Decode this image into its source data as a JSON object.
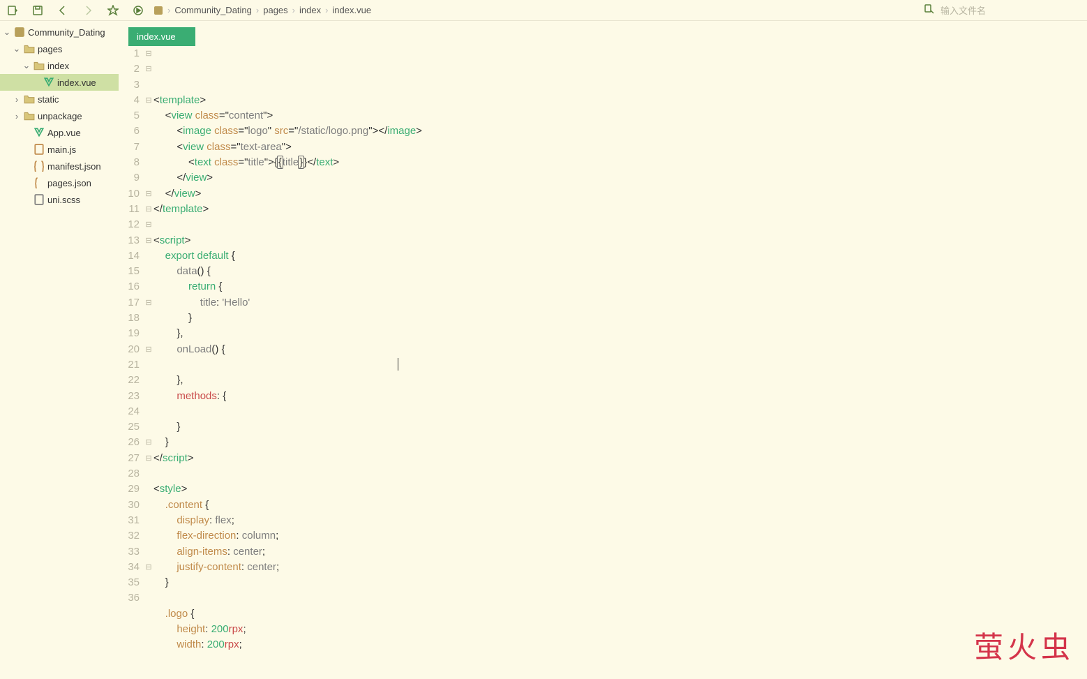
{
  "toolbar": {
    "search_placeholder": "输入文件名"
  },
  "breadcrumbs": [
    "Community_Dating",
    "pages",
    "index",
    "index.vue"
  ],
  "tree": {
    "root": {
      "name": "Community_Dating",
      "kind": "project",
      "open": true,
      "children": [
        {
          "name": "pages",
          "kind": "folder",
          "open": true,
          "children": [
            {
              "name": "index",
              "kind": "folder",
              "open": true,
              "children": [
                {
                  "name": "index.vue",
                  "kind": "vue",
                  "selected": true
                }
              ]
            }
          ]
        },
        {
          "name": "static",
          "kind": "folder",
          "open": false
        },
        {
          "name": "unpackage",
          "kind": "folder",
          "open": false
        },
        {
          "name": "App.vue",
          "kind": "vue"
        },
        {
          "name": "main.js",
          "kind": "js"
        },
        {
          "name": "manifest.json",
          "kind": "json"
        },
        {
          "name": "pages.json",
          "kind": "json"
        },
        {
          "name": "uni.scss",
          "kind": "scss"
        }
      ]
    }
  },
  "tabs": {
    "active": "index.vue"
  },
  "code": {
    "lines": [
      [
        [
          "punc",
          "<"
        ],
        [
          "tag",
          "template"
        ],
        [
          "punc",
          ">"
        ]
      ],
      [
        [
          "ws",
          "    "
        ],
        [
          "punc",
          "<"
        ],
        [
          "tag",
          "view"
        ],
        [
          "ws",
          " "
        ],
        [
          "attr",
          "class"
        ],
        [
          "punc",
          "="
        ],
        [
          "punc",
          "\""
        ],
        [
          "str",
          "content"
        ],
        [
          "punc",
          "\""
        ],
        [
          "punc",
          ">"
        ]
      ],
      [
        [
          "ws",
          "        "
        ],
        [
          "punc",
          "<"
        ],
        [
          "tag",
          "image"
        ],
        [
          "ws",
          " "
        ],
        [
          "attr",
          "class"
        ],
        [
          "punc",
          "="
        ],
        [
          "punc",
          "\""
        ],
        [
          "str",
          "logo"
        ],
        [
          "punc",
          "\""
        ],
        [
          "ws",
          " "
        ],
        [
          "attr",
          "src"
        ],
        [
          "punc",
          "="
        ],
        [
          "punc",
          "\""
        ],
        [
          "str",
          "/static/logo.png"
        ],
        [
          "punc",
          "\""
        ],
        [
          "punc",
          ">"
        ],
        [
          "punc",
          "</"
        ],
        [
          "tag",
          "image"
        ],
        [
          "punc",
          ">"
        ]
      ],
      [
        [
          "ws",
          "        "
        ],
        [
          "punc",
          "<"
        ],
        [
          "tag",
          "view"
        ],
        [
          "ws",
          " "
        ],
        [
          "attr",
          "class"
        ],
        [
          "punc",
          "="
        ],
        [
          "punc",
          "\""
        ],
        [
          "str",
          "text-area"
        ],
        [
          "punc",
          "\""
        ],
        [
          "punc",
          ">"
        ]
      ],
      [
        [
          "ws",
          "            "
        ],
        [
          "punc",
          "<"
        ],
        [
          "tag",
          "text"
        ],
        [
          "ws",
          " "
        ],
        [
          "attr",
          "class"
        ],
        [
          "punc",
          "="
        ],
        [
          "punc",
          "\""
        ],
        [
          "str",
          "title"
        ],
        [
          "punc",
          "\""
        ],
        [
          "punc",
          ">"
        ],
        [
          "punc",
          "{"
        ],
        [
          "boxed",
          "{"
        ],
        [
          "ident",
          "title"
        ],
        [
          "boxed",
          "}"
        ],
        [
          "punc",
          "}"
        ],
        [
          "punc",
          "</"
        ],
        [
          "tag",
          "text"
        ],
        [
          "punc",
          ">"
        ]
      ],
      [
        [
          "ws",
          "        "
        ],
        [
          "punc",
          "</"
        ],
        [
          "tag",
          "view"
        ],
        [
          "punc",
          ">"
        ]
      ],
      [
        [
          "ws",
          "    "
        ],
        [
          "punc",
          "</"
        ],
        [
          "tag",
          "view"
        ],
        [
          "punc",
          ">"
        ]
      ],
      [
        [
          "punc",
          "</"
        ],
        [
          "tag",
          "template"
        ],
        [
          "punc",
          ">"
        ]
      ],
      [],
      [
        [
          "punc",
          "<"
        ],
        [
          "tag",
          "script"
        ],
        [
          "punc",
          ">"
        ]
      ],
      [
        [
          "ws",
          "    "
        ],
        [
          "kw",
          "export"
        ],
        [
          "ws",
          " "
        ],
        [
          "kw",
          "default"
        ],
        [
          "ws",
          " "
        ],
        [
          "punc",
          "{"
        ]
      ],
      [
        [
          "ws",
          "        "
        ],
        [
          "ident",
          "data"
        ],
        [
          "punc",
          "() {"
        ]
      ],
      [
        [
          "ws",
          "            "
        ],
        [
          "kw",
          "return"
        ],
        [
          "ws",
          " "
        ],
        [
          "punc",
          "{"
        ]
      ],
      [
        [
          "ws",
          "                "
        ],
        [
          "ident",
          "title"
        ],
        [
          "punc",
          ": "
        ],
        [
          "str",
          "'Hello'"
        ]
      ],
      [
        [
          "ws",
          "            "
        ],
        [
          "punc",
          "}"
        ]
      ],
      [
        [
          "ws",
          "        "
        ],
        [
          "punc",
          "},"
        ]
      ],
      [
        [
          "ws",
          "        "
        ],
        [
          "ident",
          "onLoad"
        ],
        [
          "punc",
          "() {"
        ]
      ],
      [],
      [
        [
          "ws",
          "        "
        ],
        [
          "punc",
          "},"
        ]
      ],
      [
        [
          "ws",
          "        "
        ],
        [
          "err",
          "methods"
        ],
        [
          "punc",
          ": {"
        ]
      ],
      [],
      [
        [
          "ws",
          "        "
        ],
        [
          "punc",
          "}"
        ]
      ],
      [
        [
          "ws",
          "    "
        ],
        [
          "punc",
          "}"
        ]
      ],
      [
        [
          "punc",
          "</"
        ],
        [
          "tag",
          "script"
        ],
        [
          "punc",
          ">"
        ]
      ],
      [],
      [
        [
          "punc",
          "<"
        ],
        [
          "tag",
          "style"
        ],
        [
          "punc",
          ">"
        ]
      ],
      [
        [
          "ws",
          "    "
        ],
        [
          "cssel",
          ".content"
        ],
        [
          "ws",
          " "
        ],
        [
          "punc",
          "{"
        ]
      ],
      [
        [
          "ws",
          "        "
        ],
        [
          "prop",
          "display"
        ],
        [
          "punc",
          ": "
        ],
        [
          "ident",
          "flex"
        ],
        [
          "punc",
          ";"
        ]
      ],
      [
        [
          "ws",
          "        "
        ],
        [
          "prop",
          "flex-direction"
        ],
        [
          "punc",
          ": "
        ],
        [
          "ident",
          "column"
        ],
        [
          "punc",
          ";"
        ]
      ],
      [
        [
          "ws",
          "        "
        ],
        [
          "prop",
          "align-items"
        ],
        [
          "punc",
          ": "
        ],
        [
          "ident",
          "center"
        ],
        [
          "punc",
          ";"
        ]
      ],
      [
        [
          "ws",
          "        "
        ],
        [
          "prop",
          "justify-content"
        ],
        [
          "punc",
          ": "
        ],
        [
          "ident",
          "center"
        ],
        [
          "punc",
          ";"
        ]
      ],
      [
        [
          "ws",
          "    "
        ],
        [
          "punc",
          "}"
        ]
      ],
      [],
      [
        [
          "ws",
          "    "
        ],
        [
          "cssel",
          ".logo"
        ],
        [
          "ws",
          " "
        ],
        [
          "punc",
          "{"
        ]
      ],
      [
        [
          "ws",
          "        "
        ],
        [
          "prop",
          "height"
        ],
        [
          "punc",
          ": "
        ],
        [
          "num",
          "200"
        ],
        [
          "unit",
          "rpx"
        ],
        [
          "punc",
          ";"
        ]
      ],
      [
        [
          "ws",
          "        "
        ],
        [
          "prop",
          "width"
        ],
        [
          "punc",
          ": "
        ],
        [
          "num",
          "200"
        ],
        [
          "unit",
          "rpx"
        ],
        [
          "punc",
          ";"
        ]
      ]
    ],
    "fold_marks": {
      "1": "⊟",
      "2": "⊟",
      "4": "⊟",
      "10": "⊟",
      "11": "⊟",
      "12": "⊟",
      "13": "⊟",
      "17": "⊟",
      "20": "⊟",
      "26": "⊟",
      "27": "⊟",
      "34": "⊟"
    }
  },
  "watermark": "萤火虫"
}
